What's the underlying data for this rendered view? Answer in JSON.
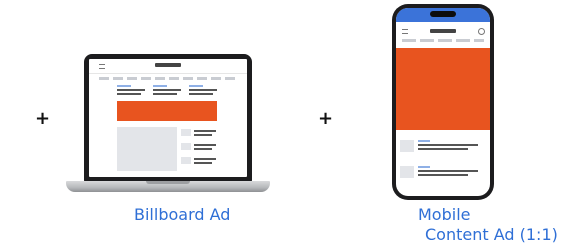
{
  "captions": {
    "billboard": "Billboard Ad",
    "mobile_line1": "Mobile",
    "mobile_line2": "Content Ad (1:1)"
  },
  "plus_sign": "+",
  "colors": {
    "caption": "#2f6fd6",
    "ad_block": "#e8541f",
    "device_frame": "#1c1c1e",
    "phone_status_bar": "#3b73d9"
  },
  "icons": [
    "laptop-mockup",
    "phone-mockup"
  ]
}
